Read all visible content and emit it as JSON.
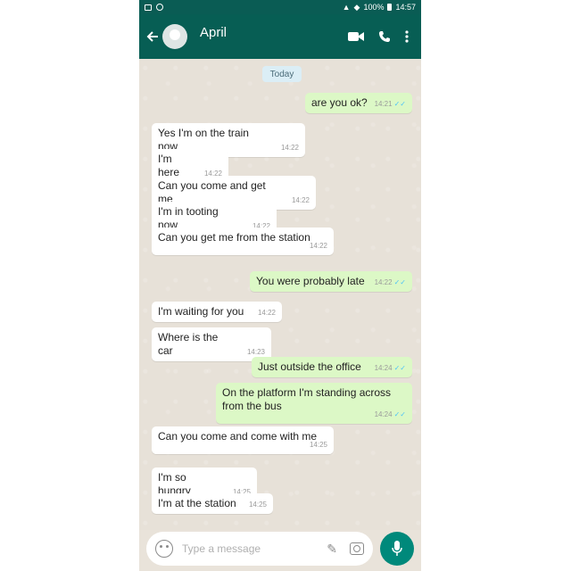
{
  "statusbar": {
    "battery": "100%",
    "time": "14:57"
  },
  "header": {
    "contact_name": "April"
  },
  "chat": {
    "date_label": "Today",
    "messages": [
      {
        "dir": "out",
        "text": "are you ok?",
        "time": "14:21"
      },
      {
        "dir": "in",
        "text": "Yes I'm on the train now",
        "time": "14:22"
      },
      {
        "dir": "in",
        "text": "I'm here",
        "time": "14:22"
      },
      {
        "dir": "in",
        "text": "Can you come and get me",
        "time": "14:22"
      },
      {
        "dir": "in",
        "text": "I'm in tooting now",
        "time": "14:22"
      },
      {
        "dir": "in",
        "text": "Can you get me from the station",
        "time": "14:22"
      },
      {
        "dir": "out",
        "text": "You were probably late",
        "time": "14:22"
      },
      {
        "dir": "in",
        "text": "I'm waiting for you",
        "time": "14:22"
      },
      {
        "dir": "in",
        "text": "Where is the car",
        "time": "14:23"
      },
      {
        "dir": "out",
        "text": "Just outside the office",
        "time": "14:24"
      },
      {
        "dir": "out",
        "text": "On the platform I'm standing across from the bus",
        "time": "14:24"
      },
      {
        "dir": "in",
        "text": "Can you come and come with me",
        "time": "14:25"
      },
      {
        "dir": "in",
        "text": "I'm so hungry",
        "time": "14:25"
      },
      {
        "dir": "in",
        "text": "I'm at the station",
        "time": "14:25"
      }
    ]
  },
  "composer": {
    "placeholder": "Type a message"
  },
  "colors": {
    "header": "#075e54",
    "outgoing_bubble": "#dcf8c6",
    "incoming_bubble": "#ffffff",
    "mic_button": "#00897b"
  }
}
